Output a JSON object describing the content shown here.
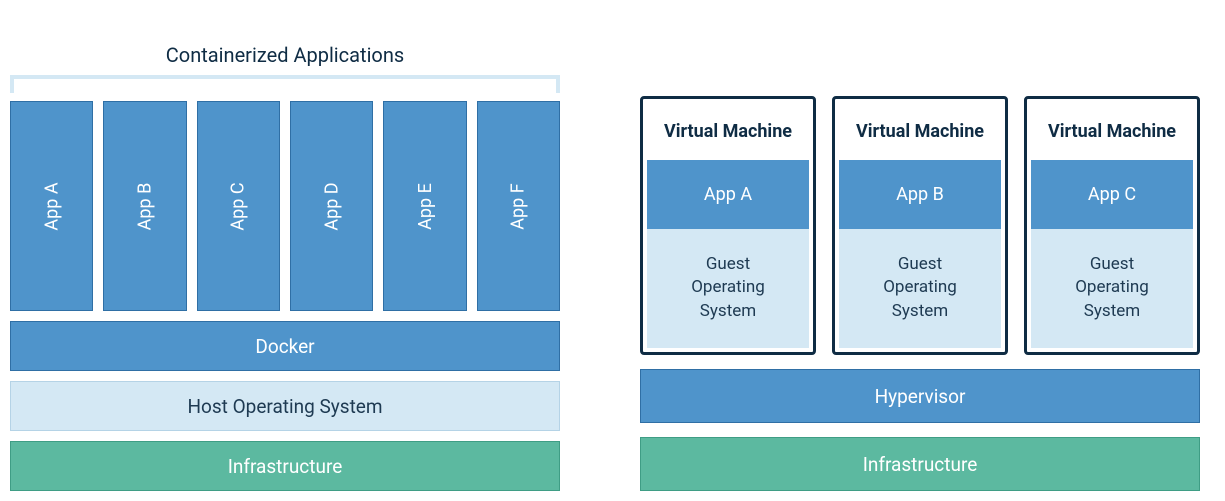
{
  "container_side": {
    "title": "Containerized Applications",
    "apps": [
      "App A",
      "App B",
      "App C",
      "App D",
      "App E",
      "App F"
    ],
    "docker_label": "Docker",
    "host_os_label": "Host Operating System",
    "infrastructure_label": "Infrastructure"
  },
  "vm_side": {
    "vms": [
      {
        "title": "Virtual Machine",
        "app": "App A",
        "guest_os": "Guest Operating System"
      },
      {
        "title": "Virtual Machine",
        "app": "App B",
        "guest_os": "Guest Operating System"
      },
      {
        "title": "Virtual Machine",
        "app": "App C",
        "guest_os": "Guest Operating System"
      }
    ],
    "hypervisor_label": "Hypervisor",
    "infrastructure_label": "Infrastructure"
  },
  "colors": {
    "blue": "#4f94cb",
    "light_blue": "#d4e8f4",
    "teal": "#5cb9a0",
    "dark_navy": "#0f2c44"
  }
}
